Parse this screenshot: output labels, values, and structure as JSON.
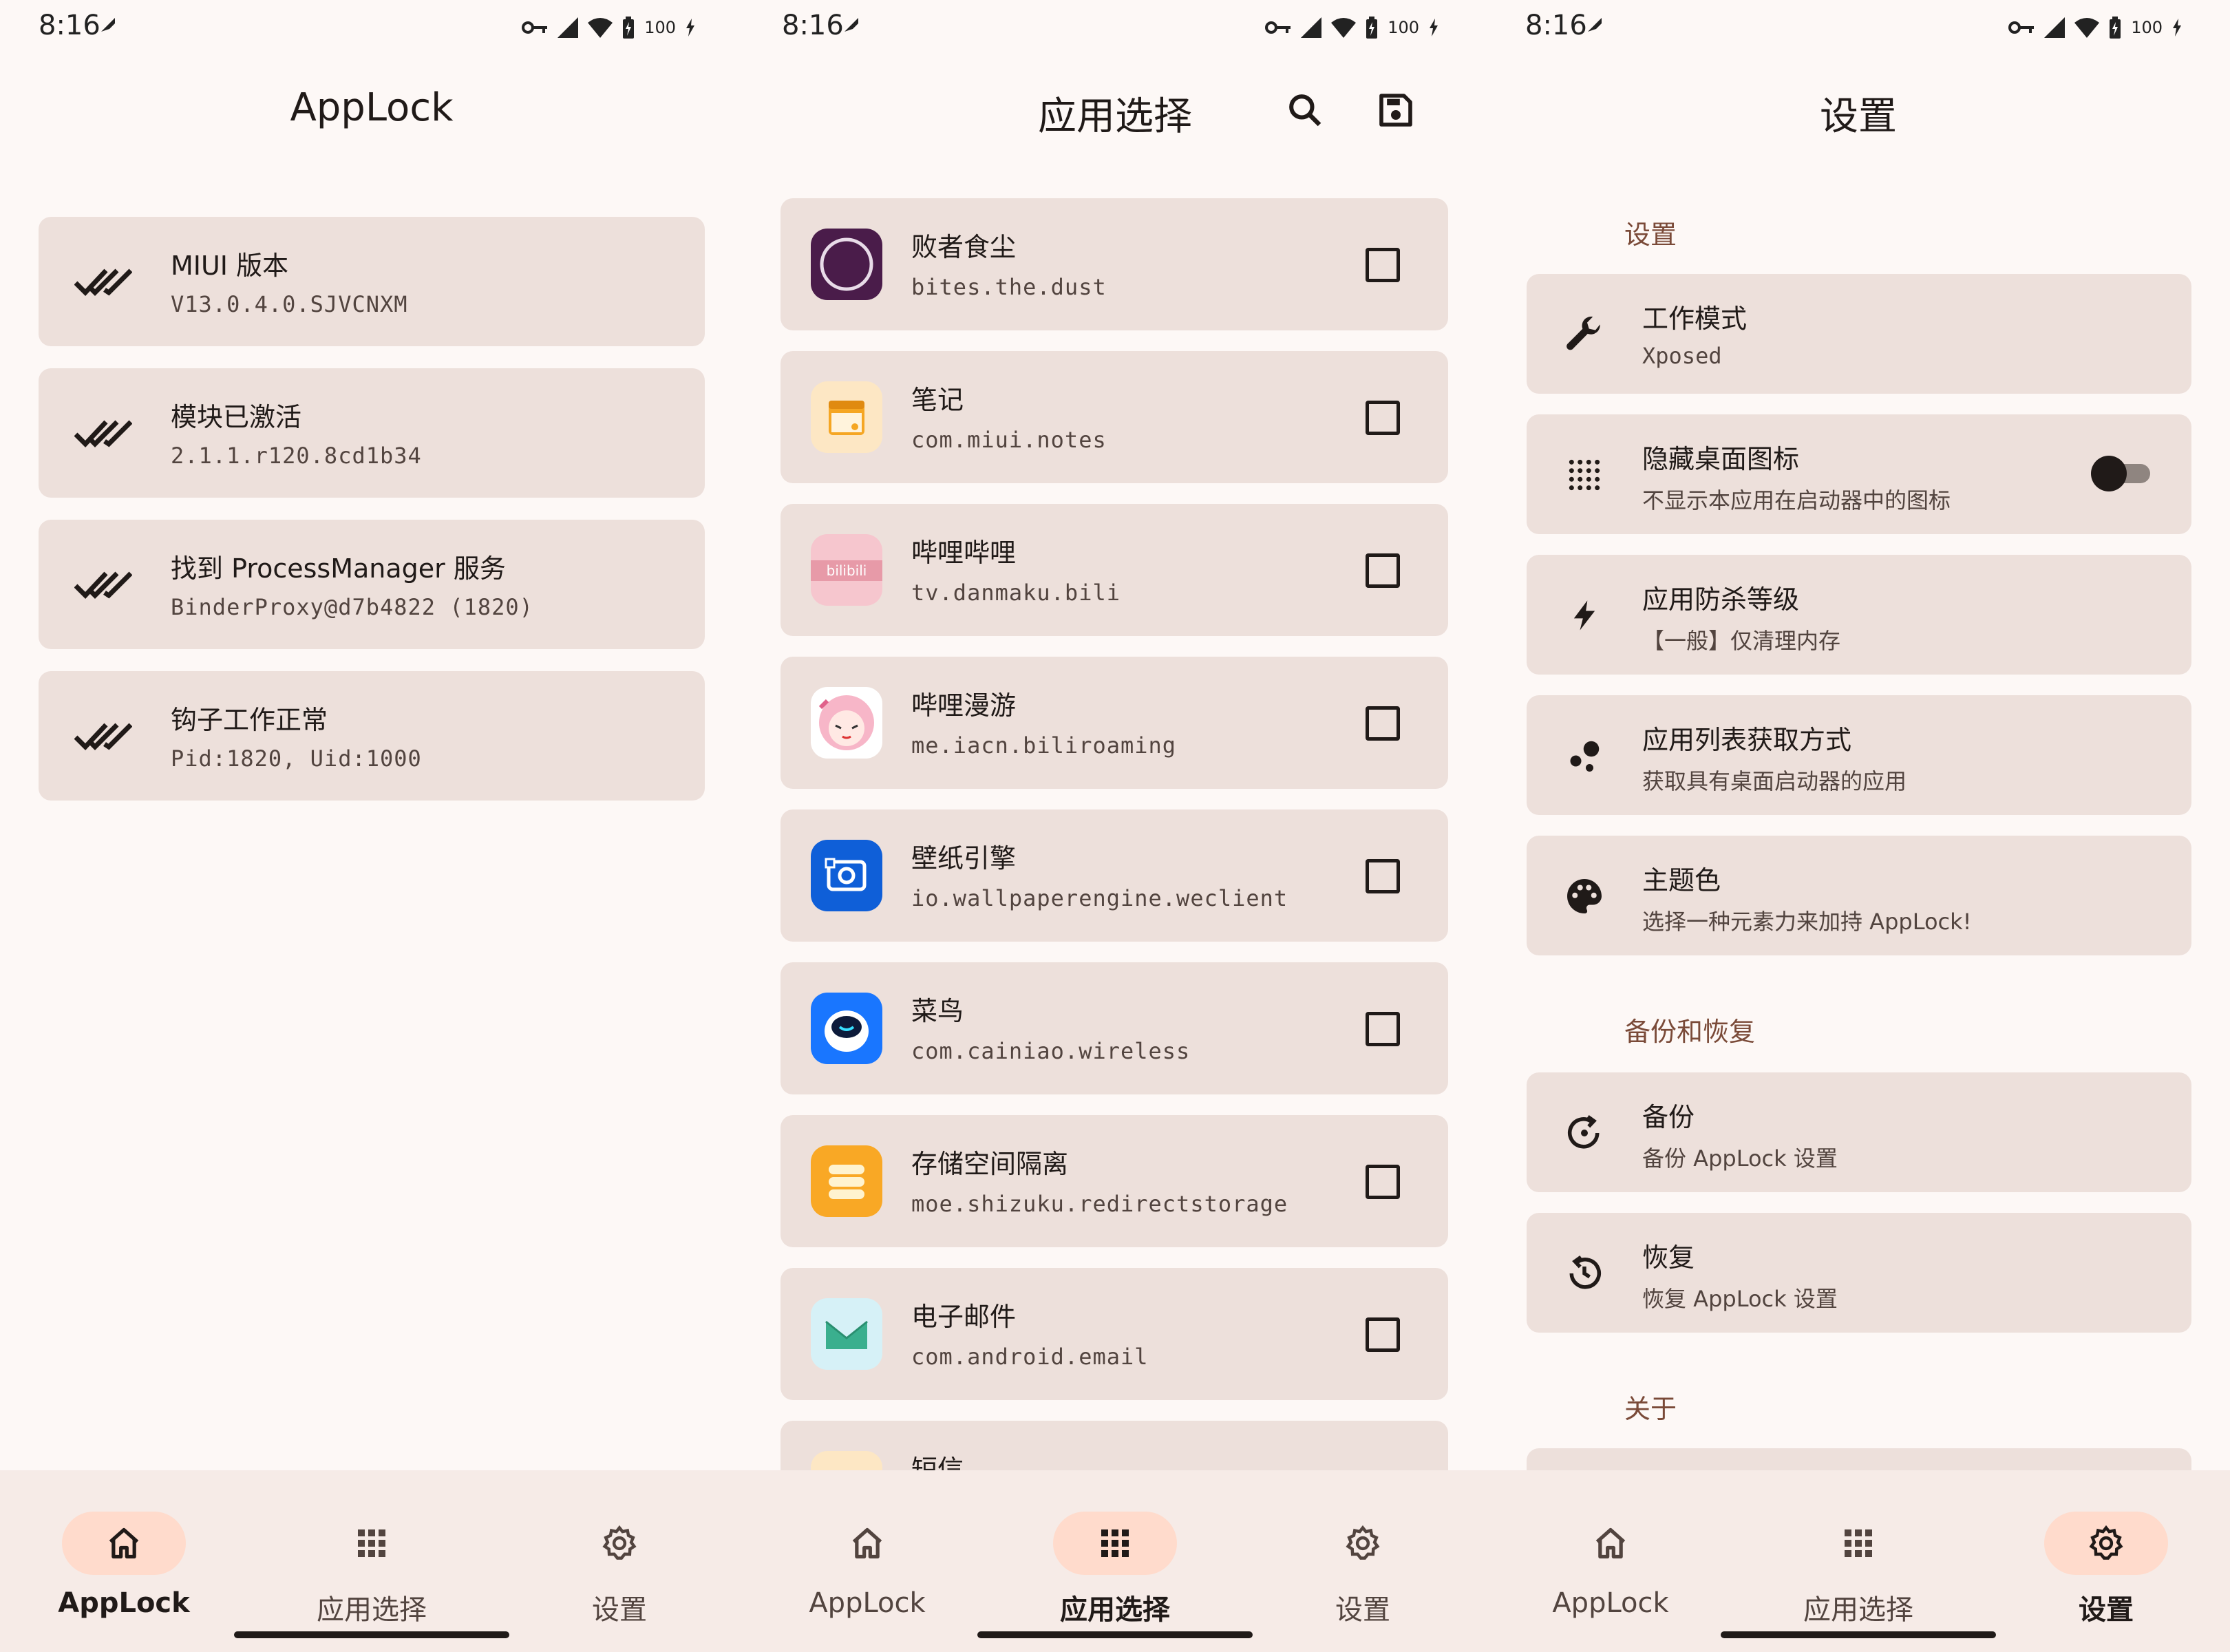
{
  "status_bar": {
    "time": "8:16",
    "battery": "100"
  },
  "nav": {
    "home": "AppLock",
    "apps": "应用选择",
    "settings": "设置"
  },
  "screen1": {
    "title": "AppLock",
    "cards": [
      {
        "title": "MIUI 版本",
        "subtitle": "V13.0.4.0.SJVCNXM"
      },
      {
        "title": "模块已激活",
        "subtitle": "2.1.1.r120.8cd1b34"
      },
      {
        "title": "找到 ProcessManager 服务",
        "subtitle": "BinderProxy@d7b4822 (1820)"
      },
      {
        "title": "钩子工作正常",
        "subtitle": "Pid:1820, Uid:1000"
      }
    ]
  },
  "screen2": {
    "title": "应用选择",
    "apps": [
      {
        "name": "败者食尘",
        "package": "bites.the.dust",
        "icon": "bites-the-dust-icon",
        "checked": false
      },
      {
        "name": "笔记",
        "package": "com.miui.notes",
        "icon": "notes-icon",
        "checked": false
      },
      {
        "name": "哔哩哔哩",
        "package": "tv.danmaku.bili",
        "icon": "bilibili-icon",
        "checked": false
      },
      {
        "name": "哔哩漫游",
        "package": "me.iacn.biliroaming",
        "icon": "biliroaming-icon",
        "checked": false
      },
      {
        "name": "壁纸引擎",
        "package": "io.wallpaperengine.weclient",
        "icon": "wallpaper-engine-icon",
        "checked": false
      },
      {
        "name": "菜鸟",
        "package": "com.cainiao.wireless",
        "icon": "cainiao-icon",
        "checked": false
      },
      {
        "name": "存储空间隔离",
        "package": "moe.shizuku.redirectstorage",
        "icon": "storage-isolation-icon",
        "checked": false
      },
      {
        "name": "电子邮件",
        "package": "com.android.email",
        "icon": "email-icon",
        "checked": false
      },
      {
        "name": "短信",
        "package": "",
        "icon": "sms-icon",
        "checked": false
      }
    ]
  },
  "screen3": {
    "title": "设置",
    "sections": {
      "settings": "设置",
      "backup": "备份和恢复",
      "about": "关于"
    },
    "items": [
      {
        "title": "工作模式",
        "subtitle": "Xposed",
        "icon": "wrench-icon"
      },
      {
        "title": "隐藏桌面图标",
        "subtitle": "不显示本应用在启动器中的图标",
        "icon": "dots-grid-icon",
        "toggle": false
      },
      {
        "title": "应用防杀等级",
        "subtitle": "【一般】仅清理内存",
        "icon": "bolt-icon"
      },
      {
        "title": "应用列表获取方式",
        "subtitle": "获取具有桌面启动器的应用",
        "icon": "bubbles-icon"
      },
      {
        "title": "主题色",
        "subtitle": "选择一种元素力来加持 AppLock!",
        "icon": "palette-icon"
      },
      {
        "title": "备份",
        "subtitle": "备份 AppLock 设置",
        "icon": "backup-icon"
      },
      {
        "title": "恢复",
        "subtitle": "恢复 AppLock 设置",
        "icon": "restore-icon"
      }
    ]
  },
  "colors": {
    "card": "#ede0db",
    "accent_pill": "#ffdbcc",
    "background": "#fdf8f6",
    "section_header": "#7a4a38"
  }
}
